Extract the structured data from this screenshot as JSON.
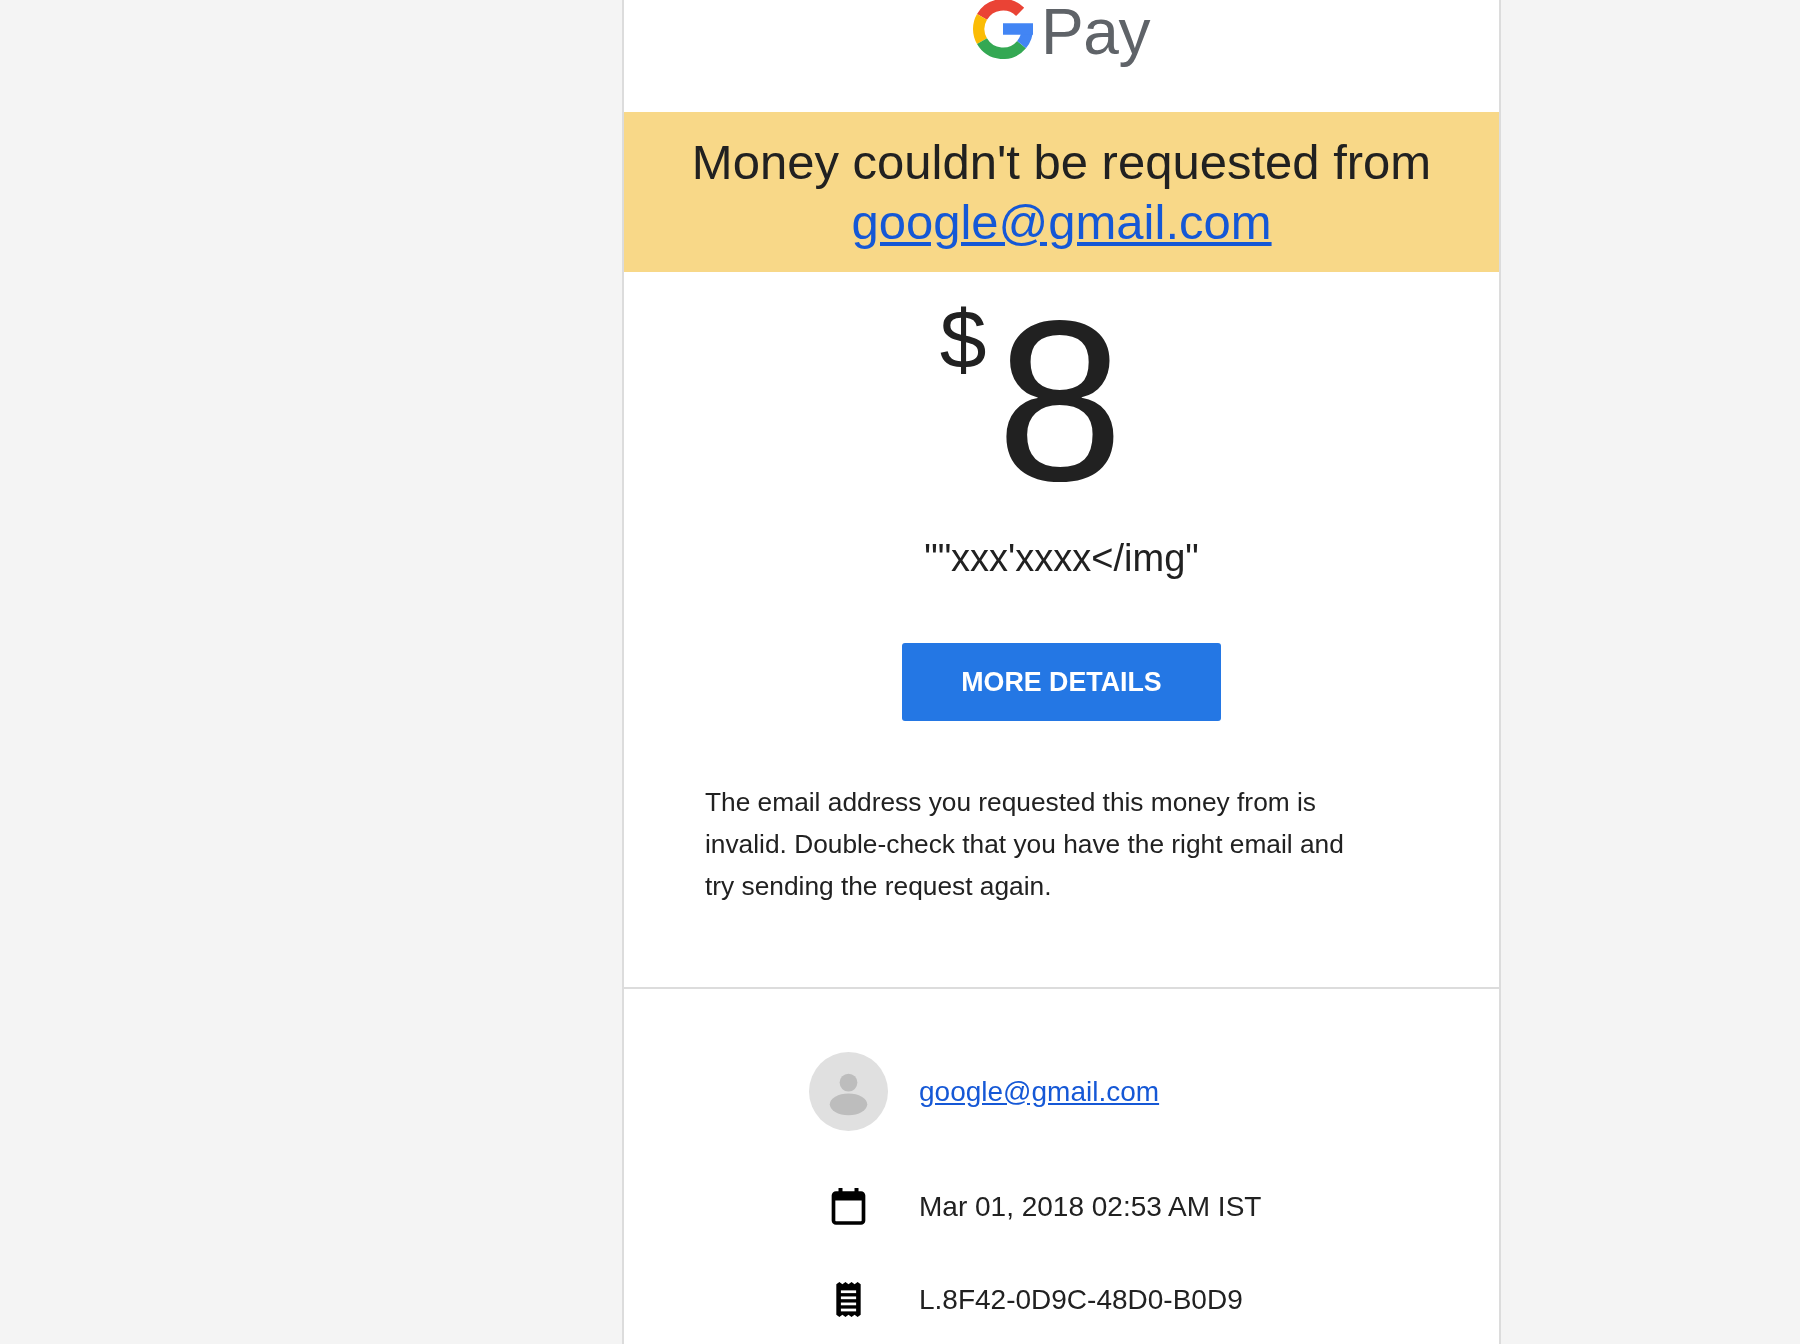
{
  "logo": {
    "text": "Pay"
  },
  "banner": {
    "message": "Money couldn't be requested from",
    "recipient": "google@gmail.com"
  },
  "amount": {
    "currency": "$",
    "value": "8"
  },
  "memo": "\"\"xxx'xxxx</img\"",
  "button": {
    "label": "MORE DETAILS"
  },
  "description": "The email address you requested this money from is invalid. Double-check that you have the right email and try sending the request again.",
  "details": [
    {
      "kind": "contact",
      "text": "google@gmail.com"
    },
    {
      "kind": "date",
      "text": "Mar 01, 2018 02:53 AM IST"
    },
    {
      "kind": "reference",
      "text": "L.8F42-0D9C-48D0-B0D9"
    }
  ]
}
